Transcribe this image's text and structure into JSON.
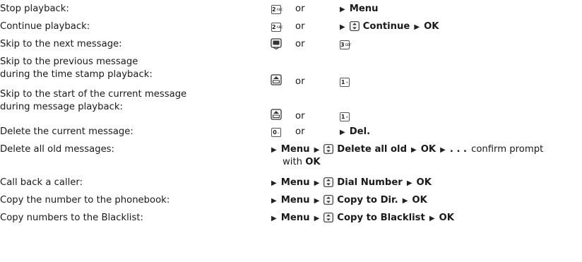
{
  "rows": [
    {
      "label": "Stop playback:",
      "key": {
        "digit": "2",
        "sub": "ABC"
      },
      "or": "or",
      "cmd": [
        "Menu"
      ]
    },
    {
      "label": "Continue playback:",
      "key": {
        "digit": "2",
        "sub": "ABC"
      },
      "or": "or",
      "cmd": [
        "Continue",
        "OK"
      ]
    },
    {
      "label": "Skip to the next message:",
      "or": "or",
      "key": {
        "digit": "3",
        "sub": "DEF"
      }
    },
    {
      "label_line1": "Skip to the previous message",
      "label_line2": "during the time stamp playback:",
      "or": "or",
      "key": {
        "digit": "1",
        "sub": "∞"
      }
    },
    {
      "label_line1": "Skip to the start of the current message",
      "label_line2": "during message playback:",
      "or": "or",
      "key": {
        "digit": "1",
        "sub": "∞"
      }
    },
    {
      "label": "Delete the current message:",
      "key": {
        "digit": "0",
        "sub": "⌣"
      },
      "or": "or",
      "cmd": [
        "Del."
      ]
    },
    {
      "label": "Delete all old messages:",
      "cmd": [
        "Menu",
        "Delete all old",
        "OK"
      ],
      "tail_dots": ". . .",
      "tail_text": "confirm prompt",
      "line2_prefix": "with",
      "line2_bold": "OK"
    },
    {
      "label": "Call back a caller:",
      "cmd": [
        "Menu",
        "Dial Number",
        "OK"
      ]
    },
    {
      "label": "Copy the number to the phonebook:",
      "cmd": [
        "Menu",
        "Copy to Dir.",
        "OK"
      ]
    },
    {
      "label": "Copy numbers to the Blacklist:",
      "cmd": [
        "Menu",
        "Copy to Blacklist",
        "OK"
      ]
    }
  ],
  "icons": {
    "arrow": "play-triangle-icon",
    "nav": "nav-key-updown-icon",
    "answer": "answering-machine-key-icon",
    "up": "control-up-key-icon"
  }
}
